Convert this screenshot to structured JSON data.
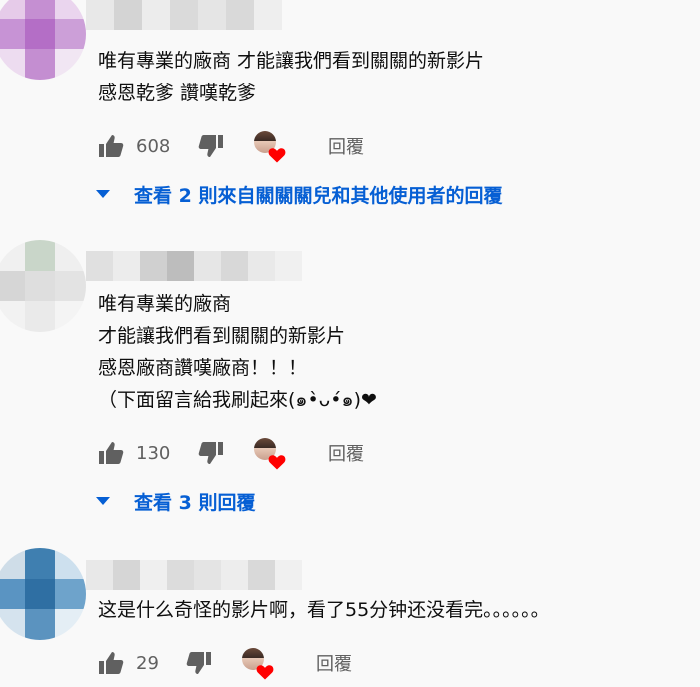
{
  "comments": [
    {
      "text": "唯有專業的廠商 才能讓我們看到關關的新影片\n感恩乾爹 讚嘆乾爹",
      "likes": "608",
      "reply_label": "回覆",
      "view_replies": "查看 2 則來自關關關兒和其他使用者的回覆"
    },
    {
      "text": "唯有專業的廠商\n才能讓我們看到關關的新影片\n感恩廠商讚嘆廠商！！！\n（下面留言給我刷起來(๑•̀ᴗ•́๑)❤",
      "likes": "130",
      "reply_label": "回覆",
      "view_replies": "查看 3 則回覆"
    },
    {
      "text": "这是什么奇怪的影片啊，看了55分钟还没看完。。。。。。",
      "likes": "29",
      "reply_label": "回覆"
    }
  ],
  "icons": {
    "like": "thumb-up-icon",
    "dislike": "thumb-down-icon",
    "creator_heart": "creator-heart-icon",
    "expand": "caret-down-icon"
  },
  "colors": {
    "link": "#065fd4",
    "secondary_text": "#606060",
    "heart": "#ff0000"
  }
}
